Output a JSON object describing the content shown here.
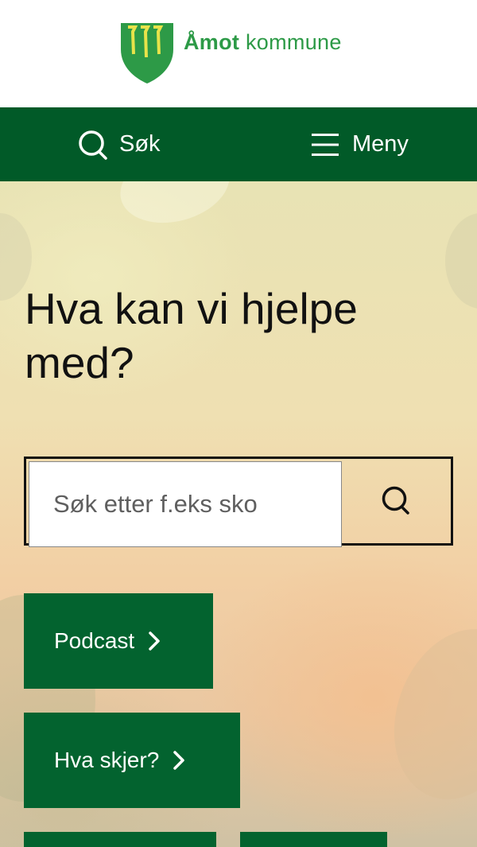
{
  "header": {
    "logo": {
      "name_bold": "Åmot",
      "name_rest": " kommune",
      "shield_color": "#2d9a47",
      "emblem_color": "#e8e34a"
    }
  },
  "nav": {
    "search_label": "Søk",
    "search_icon": "search-icon",
    "menu_label": "Meny",
    "menu_icon": "hamburger-icon",
    "background": "#015a28"
  },
  "hero": {
    "title": "Hva kan vi hjelpe med?",
    "search": {
      "placeholder": "Søk etter f.eks sko",
      "value": "",
      "submit_icon": "search-icon"
    },
    "shortcuts": [
      {
        "label": "Podcast",
        "icon": "chevron-right-icon"
      },
      {
        "label": "Hva skjer?",
        "icon": "chevron-right-icon"
      },
      {
        "label": "",
        "icon": ""
      },
      {
        "label": "",
        "icon": ""
      }
    ],
    "accent": "#03632f"
  }
}
